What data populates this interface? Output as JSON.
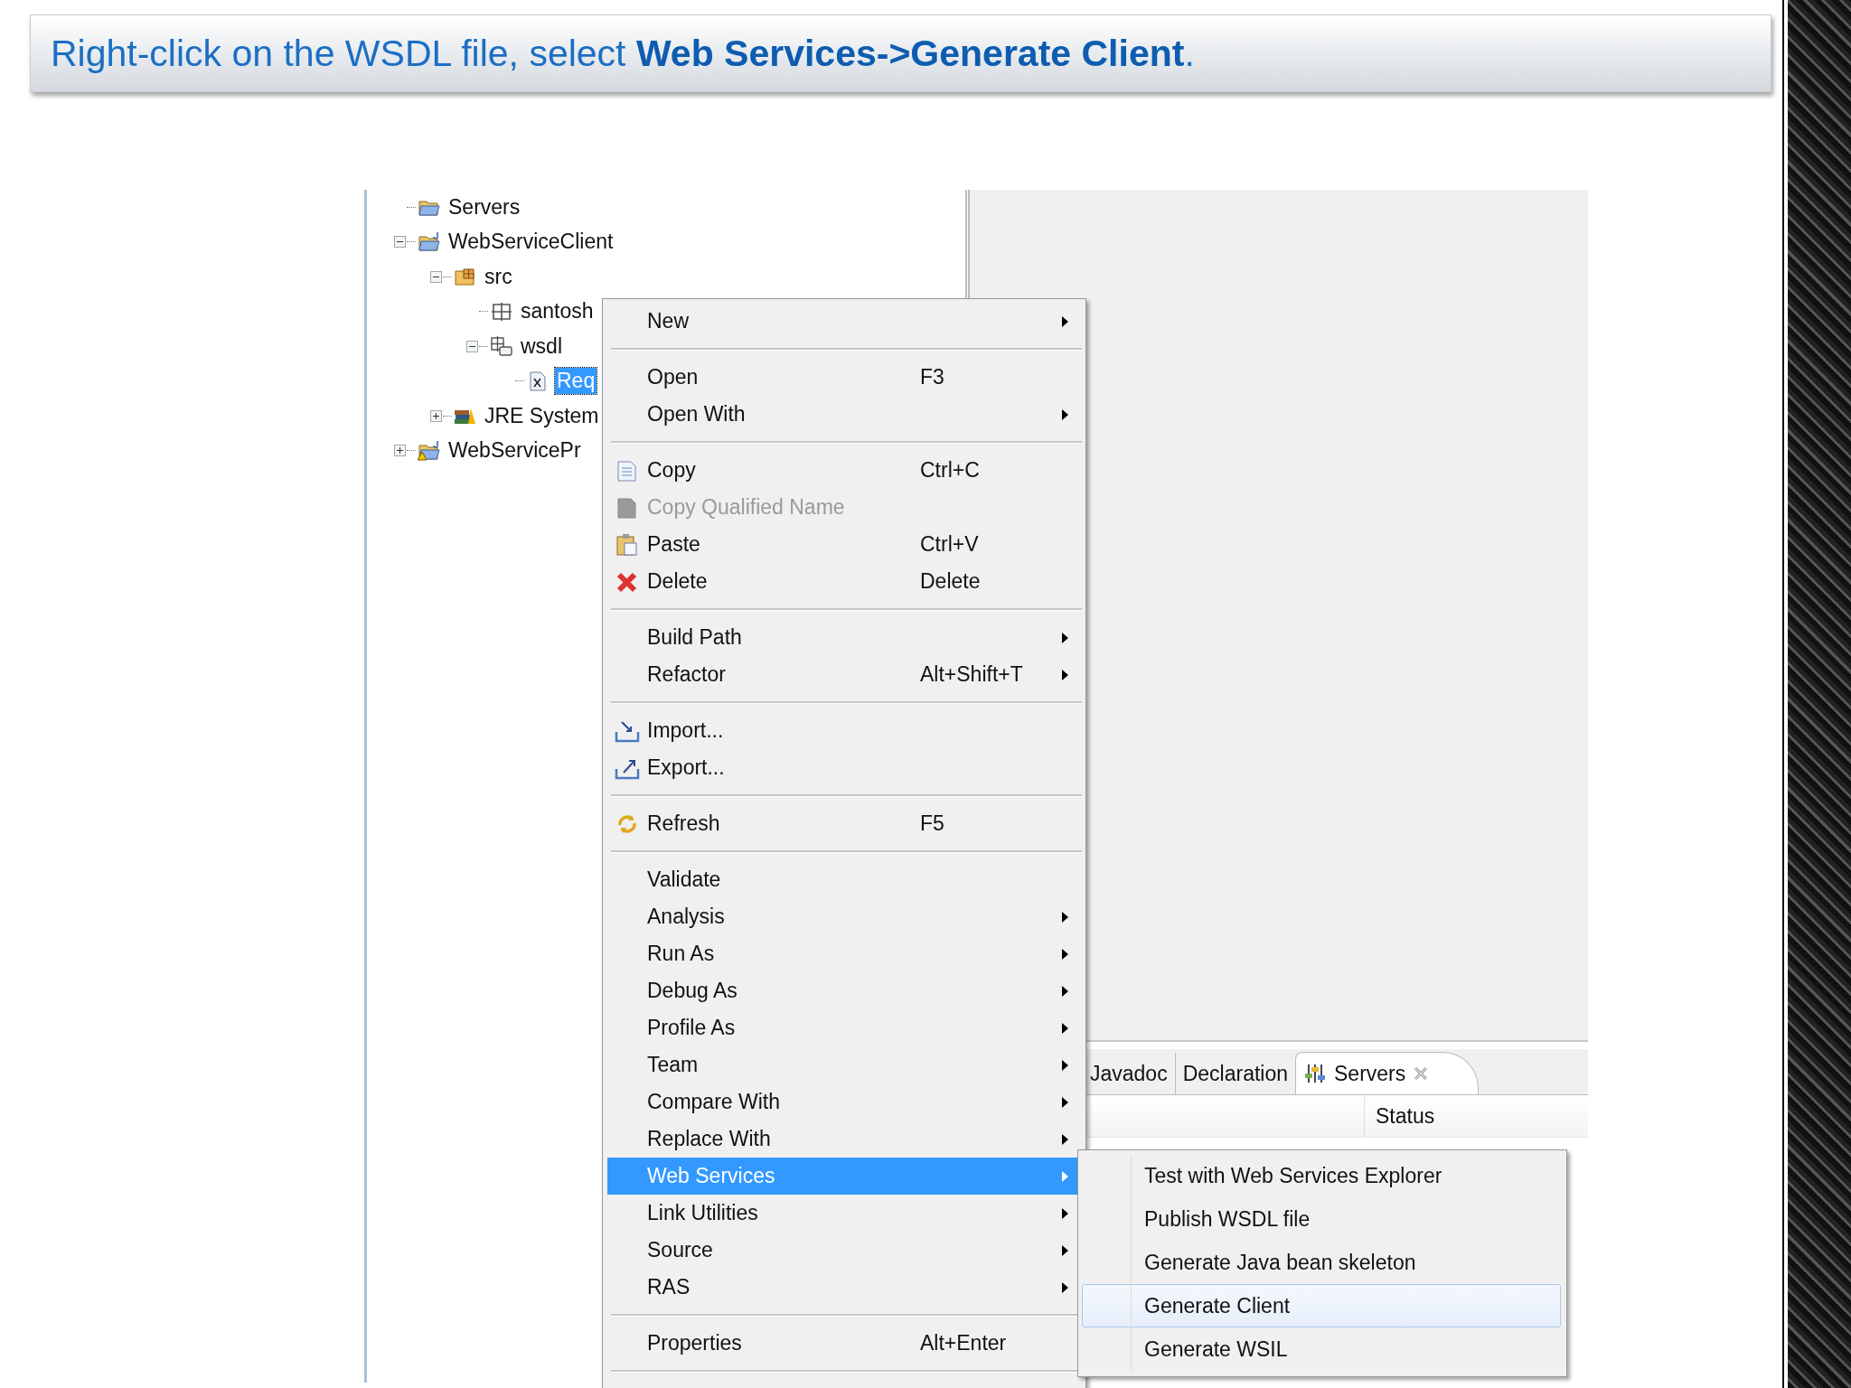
{
  "slide": {
    "instruction": "Right-click on the WSDL file, select **Web Services->Generate Client**."
  },
  "tree": [
    {
      "label": "Servers",
      "kind": "folder",
      "selected": false
    },
    {
      "label": "WebServiceClient",
      "kind": "project",
      "expanded": true,
      "selected": false,
      "children": [
        {
          "label": "src",
          "kind": "source-folder",
          "expanded": true,
          "selected": false,
          "children": [
            {
              "label": "santosh",
              "kind": "package",
              "selected": false
            },
            {
              "label": "wsdl",
              "kind": "wsdl-package",
              "expanded": true,
              "selected": false,
              "children": [
                {
                  "label": "Req",
                  "kind": "xml-file",
                  "selected": true
                }
              ]
            }
          ]
        },
        {
          "label": "JRE System",
          "kind": "library",
          "expanded": false,
          "selected": false
        }
      ]
    },
    {
      "label": "WebServicePr",
      "kind": "project-warning",
      "expanded": false,
      "selected": false
    }
  ],
  "menu": {
    "groups": [
      {
        "items": [
          {
            "label": "New",
            "submenu": true,
            "disabled": false,
            "selected": false
          }
        ]
      },
      {
        "items": [
          {
            "label": "Open",
            "shortcut": "F3",
            "submenu": false,
            "disabled": false,
            "selected": false
          },
          {
            "label": "Open With",
            "submenu": true,
            "disabled": false,
            "selected": false
          }
        ]
      },
      {
        "items": [
          {
            "label": "Copy",
            "shortcut": "Ctrl+C",
            "kind": "copy",
            "submenu": false,
            "disabled": false,
            "selected": false
          },
          {
            "label": "Copy Qualified Name",
            "kind": "copy",
            "submenu": false,
            "disabled": true,
            "selected": false
          },
          {
            "label": "Paste",
            "shortcut": "Ctrl+V",
            "kind": "paste",
            "submenu": false,
            "disabled": false,
            "selected": false
          },
          {
            "label": "Delete",
            "shortcut": "Delete",
            "kind": "delete",
            "submenu": false,
            "disabled": false,
            "selected": false
          }
        ]
      },
      {
        "items": [
          {
            "label": "Build Path",
            "submenu": true,
            "disabled": false,
            "selected": false
          },
          {
            "label": "Refactor",
            "shortcut": "Alt+Shift+T",
            "submenu": true,
            "disabled": false,
            "selected": false
          }
        ]
      },
      {
        "items": [
          {
            "label": "Import...",
            "kind": "import",
            "submenu": false,
            "disabled": false,
            "selected": false
          },
          {
            "label": "Export...",
            "kind": "export",
            "submenu": false,
            "disabled": false,
            "selected": false
          }
        ]
      },
      {
        "items": [
          {
            "label": "Refresh",
            "shortcut": "F5",
            "kind": "refresh",
            "submenu": false,
            "disabled": false,
            "selected": false
          }
        ]
      },
      {
        "items": [
          {
            "label": "Validate",
            "submenu": false,
            "disabled": false,
            "selected": false
          },
          {
            "label": "Analysis",
            "submenu": true,
            "disabled": false,
            "selected": false
          },
          {
            "label": "Run As",
            "submenu": true,
            "disabled": false,
            "selected": false
          },
          {
            "label": "Debug As",
            "submenu": true,
            "disabled": false,
            "selected": false
          },
          {
            "label": "Profile As",
            "submenu": true,
            "disabled": false,
            "selected": false
          },
          {
            "label": "Team",
            "submenu": true,
            "disabled": false,
            "selected": false
          },
          {
            "label": "Compare With",
            "submenu": true,
            "disabled": false,
            "selected": false
          },
          {
            "label": "Replace With",
            "submenu": true,
            "disabled": false,
            "selected": false
          },
          {
            "label": "Web Services",
            "submenu": true,
            "disabled": false,
            "selected": true
          },
          {
            "label": "Link Utilities",
            "submenu": true,
            "disabled": false,
            "selected": false
          },
          {
            "label": "Source",
            "submenu": true,
            "disabled": false,
            "selected": false
          },
          {
            "label": "RAS",
            "submenu": true,
            "disabled": false,
            "selected": false
          }
        ]
      },
      {
        "items": [
          {
            "label": "Properties",
            "shortcut": "Alt+Enter",
            "submenu": false,
            "disabled": false,
            "selected": false
          }
        ]
      }
    ]
  },
  "submenu": {
    "items": [
      {
        "label": "Test with Web Services Explorer",
        "selected": false
      },
      {
        "label": "Publish WSDL file",
        "selected": false
      },
      {
        "label": "Generate Java bean skeleton",
        "selected": false
      },
      {
        "label": "Generate Client",
        "selected": true
      },
      {
        "label": "Generate WSIL",
        "selected": false
      }
    ]
  },
  "bottom_panel": {
    "tabs": [
      {
        "label": "Javadoc",
        "selected": false,
        "closable": false
      },
      {
        "label": "Declaration",
        "selected": false,
        "closable": false
      },
      {
        "label": "Servers",
        "selected": true,
        "closable": true
      }
    ],
    "table": {
      "columns": [
        "Status"
      ]
    }
  }
}
